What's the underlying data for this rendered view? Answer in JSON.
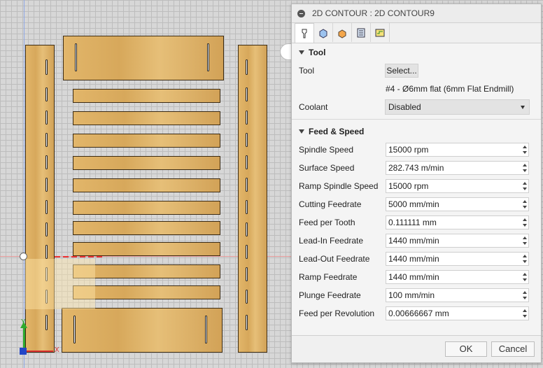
{
  "dialog": {
    "title": "2D CONTOUR : 2D CONTOUR9",
    "tabs": [
      "tool-tab",
      "geometry-tab",
      "heights-tab",
      "passes-tab",
      "linking-tab"
    ],
    "tool_section": {
      "heading": "Tool",
      "tool_label": "Tool",
      "select_button": "Select...",
      "tool_description": "#4 - Ø6mm flat (6mm Flat Endmill)",
      "coolant_label": "Coolant",
      "coolant_value": "Disabled"
    },
    "feed_section": {
      "heading": "Feed & Speed",
      "fields": [
        {
          "label": "Spindle Speed",
          "value": "15000 rpm"
        },
        {
          "label": "Surface Speed",
          "value": "282.743 m/min"
        },
        {
          "label": "Ramp Spindle Speed",
          "value": "15000 rpm"
        },
        {
          "label": "Cutting Feedrate",
          "value": "5000 mm/min"
        },
        {
          "label": "Feed per Tooth",
          "value": "0.111111 mm"
        },
        {
          "label": "Lead-In Feedrate",
          "value": "1440 mm/min"
        },
        {
          "label": "Lead-Out Feedrate",
          "value": "1440 mm/min"
        },
        {
          "label": "Ramp Feedrate",
          "value": "1440 mm/min"
        },
        {
          "label": "Plunge Feedrate",
          "value": "100 mm/min"
        },
        {
          "label": "Feed per Revolution",
          "value": "0.00666667 mm"
        }
      ]
    },
    "ok": "OK",
    "cancel": "Cancel"
  },
  "axes": {
    "x": "X",
    "y": "Y"
  },
  "colors": {
    "wood": "#dcae62",
    "grid": "#d7d7d7",
    "x_axis": "#dd3333",
    "y_axis": "#2eaa2e"
  }
}
